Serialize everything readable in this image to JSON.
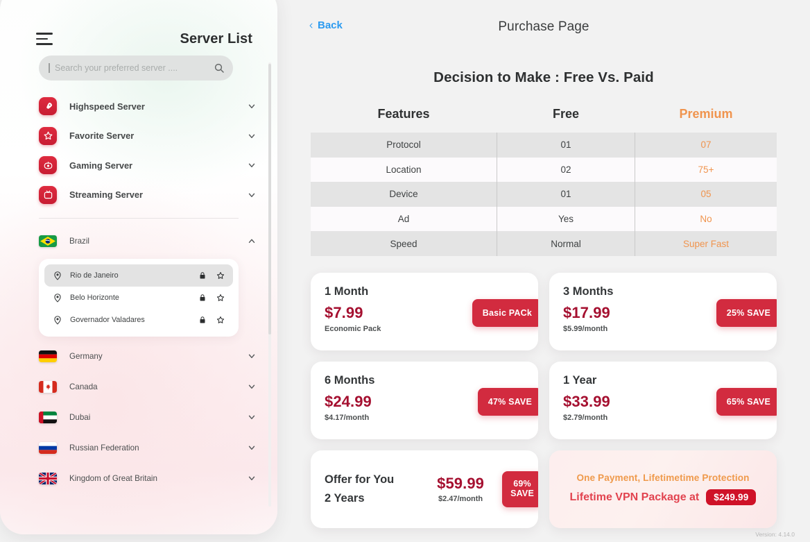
{
  "sidebar": {
    "title": "Server List",
    "menu_icon": "hamburger-icon",
    "search": {
      "placeholder": "Search your preferred server ....",
      "value": "",
      "icon": "search-icon"
    },
    "server_groups": [
      {
        "label": "Highspeed Server",
        "icon": "rocket-icon"
      },
      {
        "label": "Favorite Server",
        "icon": "star-icon"
      },
      {
        "label": "Gaming Server",
        "icon": "gamepad-icon"
      },
      {
        "label": "Streaming Server",
        "icon": "tv-icon"
      }
    ],
    "countries": [
      {
        "label": "Brazil",
        "flag": "brazil-flag",
        "expanded": true,
        "cities": [
          {
            "label": "Rio de Janeiro",
            "selected": true,
            "locked": true,
            "favorite": false
          },
          {
            "label": "Belo Horizonte",
            "selected": false,
            "locked": true,
            "favorite": false
          },
          {
            "label": "Governador Valadares",
            "selected": false,
            "locked": true,
            "favorite": false
          }
        ]
      },
      {
        "label": "Germany",
        "flag": "germany-flag",
        "expanded": false,
        "cities": []
      },
      {
        "label": "Canada",
        "flag": "canada-flag",
        "expanded": false,
        "cities": []
      },
      {
        "label": "Dubai",
        "flag": "uae-flag",
        "expanded": false,
        "cities": []
      },
      {
        "label": "Russian Federation",
        "flag": "russia-flag",
        "expanded": false,
        "cities": []
      },
      {
        "label": "Kingdom of Great Britain",
        "flag": "uk-flag",
        "expanded": false,
        "cities": []
      }
    ]
  },
  "main": {
    "back_label": "Back",
    "page_title": "Purchase Page",
    "headline": "Decision to Make : Free Vs. Paid",
    "comparison": {
      "columns": [
        "Features",
        "Free",
        "Premium"
      ],
      "rows": [
        {
          "feature": "Protocol",
          "free": "01",
          "premium": "07"
        },
        {
          "feature": "Location",
          "free": "02",
          "premium": "75+"
        },
        {
          "feature": "Device",
          "free": "01",
          "premium": "05"
        },
        {
          "feature": "Ad",
          "free": "Yes",
          "premium": "No"
        },
        {
          "feature": "Speed",
          "free": "Normal",
          "premium": "Super Fast"
        }
      ]
    },
    "plans": [
      {
        "term": "1 Month",
        "price": "$7.99",
        "sub": "Economic Pack",
        "badge": "Basic PACk"
      },
      {
        "term": "3 Months",
        "price": "$17.99",
        "sub": "$5.99/month",
        "badge": "25% SAVE"
      },
      {
        "term": "6 Months",
        "price": "$24.99",
        "sub": "$4.17/month",
        "badge": "47% SAVE"
      },
      {
        "term": "1 Year",
        "price": "$33.99",
        "sub": "$2.79/month",
        "badge": "65% SAVE"
      }
    ],
    "offer": {
      "title": "Offer for You",
      "term": "2 Years",
      "price": "$59.99",
      "sub": "$2.47/month",
      "badge_line1": "69%",
      "badge_line2": "SAVE"
    },
    "lifetime": {
      "top": "One Payment, Lifetimetime Protection",
      "bottom": "Lifetime VPN Package at",
      "price": "$249.99"
    },
    "version": "Version: 4.14.0"
  },
  "colors": {
    "brand_red": "#d22b3f",
    "price_red": "#a51030",
    "premium_orange": "#f0944e",
    "link_blue": "#2c9bf0"
  }
}
